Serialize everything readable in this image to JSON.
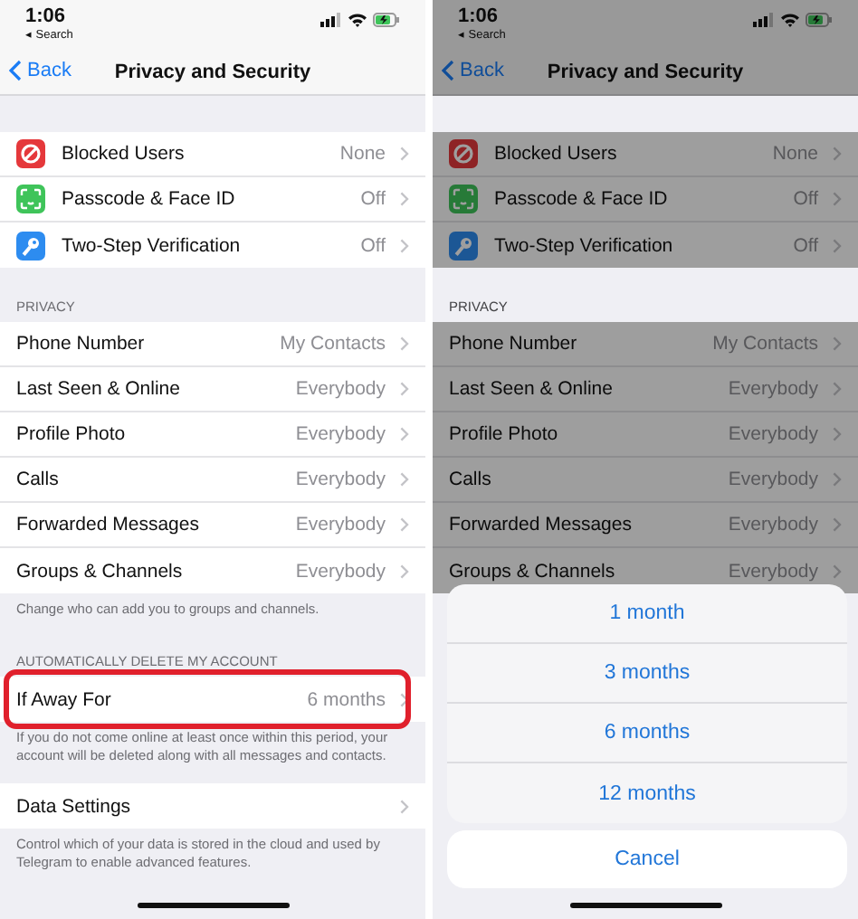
{
  "screens": [
    {
      "dimmed": false,
      "status_bar": {
        "time": "1:06",
        "back_app": "◂ Search"
      },
      "nav": {
        "back": "Back",
        "title": "Privacy and Security"
      },
      "sections": [
        {
          "rows": [
            {
              "kind": "blocked",
              "label": "Blocked Users",
              "value": "None",
              "highlighted": false
            },
            {
              "kind": "faceid",
              "label": "Passcode & Face ID",
              "value": "Off",
              "highlighted": false
            },
            {
              "kind": "key",
              "label": "Two-Step Verification",
              "value": "Off",
              "highlighted": false
            }
          ]
        },
        {
          "header": "PRIVACY",
          "rows": [
            {
              "label": "Phone Number",
              "value": "My Contacts",
              "highlighted": false
            },
            {
              "label": "Last Seen & Online",
              "value": "Everybody",
              "highlighted": false
            },
            {
              "label": "Profile Photo",
              "value": "Everybody",
              "highlighted": false
            },
            {
              "label": "Calls",
              "value": "Everybody",
              "highlighted": false
            },
            {
              "label": "Forwarded Messages",
              "value": "Everybody",
              "highlighted": false
            },
            {
              "label": "Groups & Channels",
              "value": "Everybody",
              "highlighted": false
            }
          ],
          "footer": "Change who can add you to groups and channels."
        },
        {
          "header": "AUTOMATICALLY DELETE MY ACCOUNT",
          "rows": [
            {
              "label": "If Away For",
              "value": "6 months",
              "highlighted": true
            }
          ],
          "footer": "If you do not come online at least once within this period, your account will be deleted along with all messages and contacts."
        },
        {
          "rows": [
            {
              "label": "Data Settings",
              "highlighted": false
            }
          ],
          "footer": "Control which of your data is stored in the cloud and used by Telegram to enable advanced features."
        }
      ]
    },
    {
      "dimmed": true,
      "status_bar": {
        "time": "1:06",
        "back_app": "◂ Search"
      },
      "nav": {
        "back": "Back",
        "title": "Privacy and Security"
      },
      "sections": [
        {
          "rows": [
            {
              "kind": "blocked",
              "label": "Blocked Users",
              "value": "None",
              "highlighted": false
            },
            {
              "kind": "faceid",
              "label": "Passcode & Face ID",
              "value": "Off",
              "highlighted": false
            },
            {
              "kind": "key",
              "label": "Two-Step Verification",
              "value": "Off",
              "highlighted": false
            }
          ]
        },
        {
          "header": "PRIVACY",
          "rows": [
            {
              "label": "Phone Number",
              "value": "My Contacts",
              "highlighted": false
            },
            {
              "label": "Last Seen & Online",
              "value": "Everybody",
              "highlighted": false
            },
            {
              "label": "Profile Photo",
              "value": "Everybody",
              "highlighted": false
            },
            {
              "label": "Calls",
              "value": "Everybody",
              "highlighted": false
            },
            {
              "label": "Forwarded Messages",
              "value": "Everybody",
              "highlighted": false
            },
            {
              "label": "Groups & Channels",
              "value": "Everybody",
              "highlighted": false
            }
          ]
        }
      ],
      "action_sheet": {
        "options": [
          "1 month",
          "3 months",
          "6 months",
          "12 months"
        ],
        "cancel": "Cancel"
      }
    }
  ]
}
